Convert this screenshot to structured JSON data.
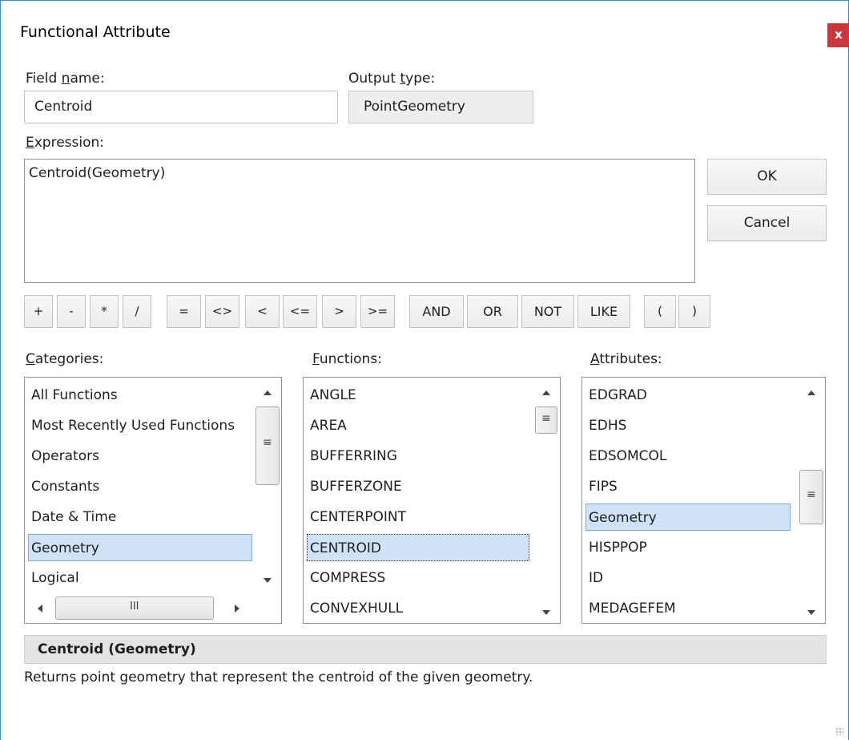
{
  "window": {
    "title": "Functional Attribute",
    "close_label": "x"
  },
  "field_name": {
    "label_pre": "Field ",
    "label_u": "n",
    "label_post": "ame:",
    "value": "Centroid"
  },
  "output_type": {
    "label_pre": "Output ",
    "label_u": "t",
    "label_post": "ype:",
    "value": "PointGeometry"
  },
  "expression": {
    "label_u": "E",
    "label_post": "xpression:",
    "value": "Centroid(Geometry)"
  },
  "buttons": {
    "ok": "OK",
    "cancel": "Cancel"
  },
  "operators": [
    "+",
    "-",
    "*",
    "/",
    "=",
    "<>",
    "<",
    "<=",
    ">",
    ">=",
    "AND",
    "OR",
    "NOT",
    "LIKE",
    "(",
    ")"
  ],
  "categories": {
    "label_u": "C",
    "label_post": "ategories:",
    "items": [
      "All Functions",
      "Most Recently Used Functions",
      "Operators",
      "Constants",
      "Date & Time",
      "Geometry",
      "Logical"
    ],
    "selected": "Geometry",
    "hscroll_grip": "III"
  },
  "functions": {
    "label_u": "F",
    "label_post": "unctions:",
    "items": [
      "ANGLE",
      "AREA",
      "BUFFERRING",
      "BUFFERZONE",
      "CENTERPOINT",
      "CENTROID",
      "COMPRESS",
      "CONVEXHULL"
    ],
    "selected": "CENTROID"
  },
  "attributes": {
    "label_u": "A",
    "label_post": "ttributes:",
    "items": [
      "EDGRAD",
      "EDHS",
      "EDSOMCOL",
      "FIPS",
      "Geometry",
      "HISPPOP",
      "ID",
      "MEDAGEFEM"
    ],
    "selected": "Geometry"
  },
  "description": {
    "heading": "Centroid (Geometry)",
    "text": "Returns point geometry that represent the centroid of the given geometry."
  },
  "icons": [
    "close-icon",
    "scroll-up-arrow-icon",
    "scroll-down-arrow-icon",
    "scroll-left-arrow-icon",
    "scroll-right-arrow-icon",
    "scroll-thumb-grip-icon",
    "resize-grip-icon"
  ]
}
